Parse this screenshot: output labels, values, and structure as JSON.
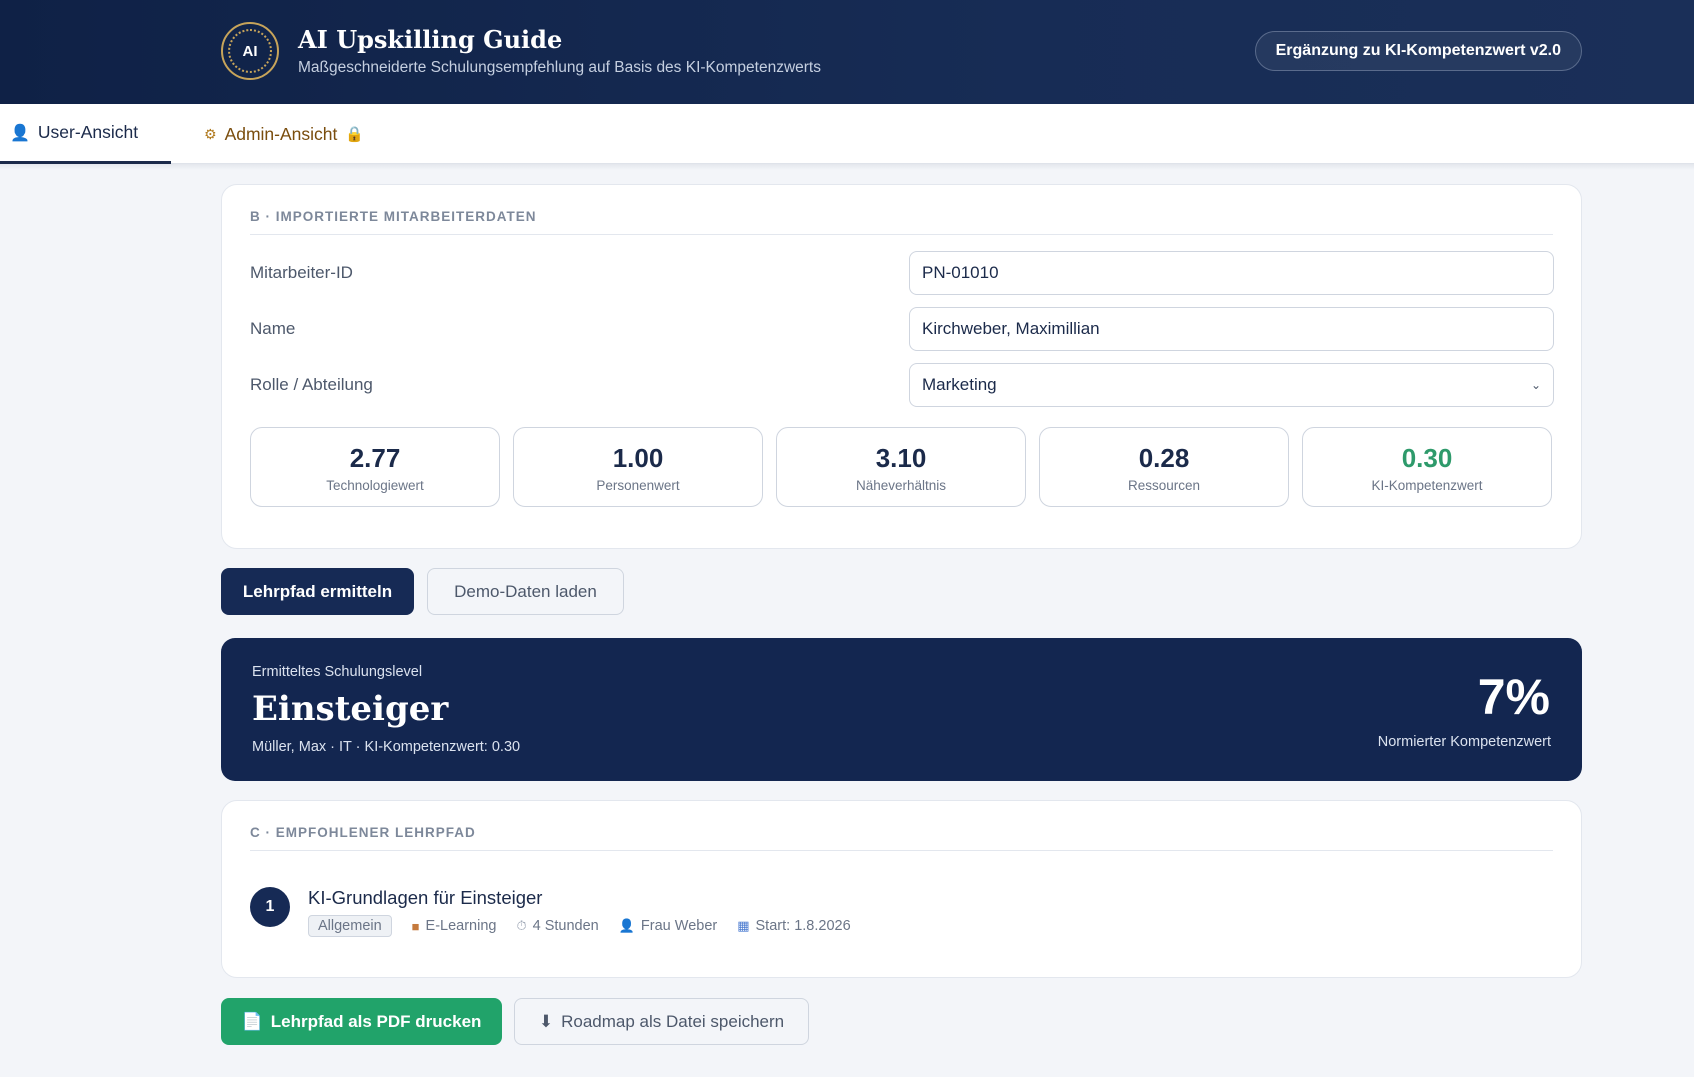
{
  "header": {
    "logo_text": "AI",
    "title": "AI Upskilling Guide",
    "subtitle": "Maßgeschneiderte Schulungsempfehlung auf Basis des KI-Kompetenzwerts",
    "version_badge": "Ergänzung zu KI-Kompetenzwert v2.0"
  },
  "tabs": [
    {
      "label": "User-Ansicht",
      "icon": "user-icon",
      "active": true
    },
    {
      "label": "Admin-Ansicht",
      "icon": "gear-icon",
      "locked": true
    }
  ],
  "section_b": {
    "heading": "B · IMPORTIERTE MITARBEITERDATEN",
    "fields": {
      "employee_id": {
        "label": "Mitarbeiter-ID",
        "value": "PN-01010"
      },
      "name": {
        "label": "Name",
        "value": "Kirchweber, Maximillian"
      },
      "role": {
        "label": "Rolle / Abteilung",
        "value": "Marketing"
      }
    },
    "metrics": [
      {
        "value": "2.77",
        "label": "Technologiewert"
      },
      {
        "value": "1.00",
        "label": "Personenwert"
      },
      {
        "value": "3.10",
        "label": "Näheverhältnis"
      },
      {
        "value": "0.28",
        "label": "Ressourcen"
      },
      {
        "value": "0.30",
        "label": "KI-Kompetenzwert"
      }
    ]
  },
  "actions": {
    "primary": "Lehrpfad ermitteln",
    "secondary": "Demo-Daten laden"
  },
  "result": {
    "caption": "Ermitteltes Schulungslevel",
    "level": "Einsteiger",
    "subline": "Müller, Max · IT · KI-Kompetenzwert: 0.30",
    "percent": "7%",
    "percent_label": "Normierter Kompetenzwert"
  },
  "section_c": {
    "heading": "C · EMPFOHLENER LEHRPFAD",
    "courses": [
      {
        "number": "1",
        "title": "KI-Grundlagen für Einsteiger",
        "tag": "Allgemein",
        "format": "E-Learning",
        "duration": "4 Stunden",
        "trainer": "Frau Weber",
        "start": "Start: 1.8.2026"
      }
    ]
  },
  "footer_actions": {
    "print": "Lehrpfad als PDF drucken",
    "save": "Roadmap als Datei speichern"
  },
  "colors": {
    "navy": "#132650",
    "accent_green": "#21a36a",
    "gold": "#c7a45a"
  }
}
